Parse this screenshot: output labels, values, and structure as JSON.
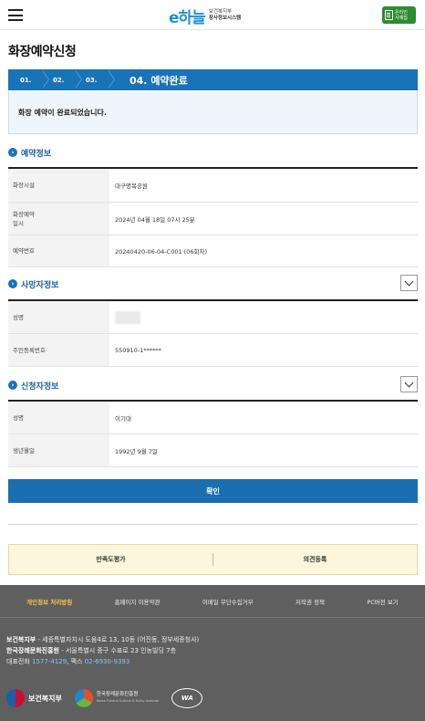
{
  "header": {
    "logo_mark": "e하늘",
    "logo_line1": "보건복지부",
    "logo_line2": "장사정보시스템",
    "online_line1": "온라인",
    "online_line2": "사례집"
  },
  "page_title": "화장예약신청",
  "steps": {
    "step1": "01.",
    "step2": "02.",
    "step3": "03.",
    "current": "04. 예약완료"
  },
  "complete_message": "화장 예약이 완료되었습니다.",
  "reservation": {
    "title": "예약정보",
    "rows": [
      {
        "label": "화장시설",
        "value": "대구명복공원"
      },
      {
        "label": "화장예약\n일시",
        "value": "2024년 04월 18일 07시 25분"
      },
      {
        "label": "예약번호",
        "value": "20240420-06-04-C001 (06회차)"
      }
    ]
  },
  "deceased": {
    "title": "사망자정보",
    "rows": [
      {
        "label": "성명",
        "value": ""
      },
      {
        "label": "주민등록번호",
        "value": "550910-1******"
      }
    ]
  },
  "applicant": {
    "title": "신청자정보",
    "rows": [
      {
        "label": "성명",
        "value": "이기대"
      },
      {
        "label": "생년월일",
        "value": "1992년 9월 7일"
      }
    ]
  },
  "confirm_label": "확인",
  "survey": {
    "satisfaction": "만족도평가",
    "opinion": "의견등록"
  },
  "footer": {
    "links": [
      "개인정보 처리방침",
      "홈페이지 이용약관",
      "이메일 무단수집거부",
      "저작권 정책",
      "PC버전 보기"
    ],
    "org1_name": "보건복지부",
    "org1_addr": " - 세종특별자치시 도움4로 13, 10동 (어진동, 정부세종청사)",
    "org2_name": "한국장례문화진흥원",
    "org2_addr": " - 서울특별시 중구 수표로 23 인농빌딩 7층",
    "tel_label": "대표전화 ",
    "tel": "1577-4129",
    "fax_label": ", 팩스 ",
    "fax": "02-6930-9393",
    "logo1": "보건복지부",
    "logo2_line1": "한국장례문화진흥원",
    "logo2_line2": "Korea Funeral Culture & Policy Institute",
    "logo3": "WA"
  },
  "colors": {
    "primary": "#1a73b6",
    "online_btn": "#2e8b2e",
    "footer_bg": "#5f5f5f",
    "survey_bg": "#fdf6dc"
  }
}
